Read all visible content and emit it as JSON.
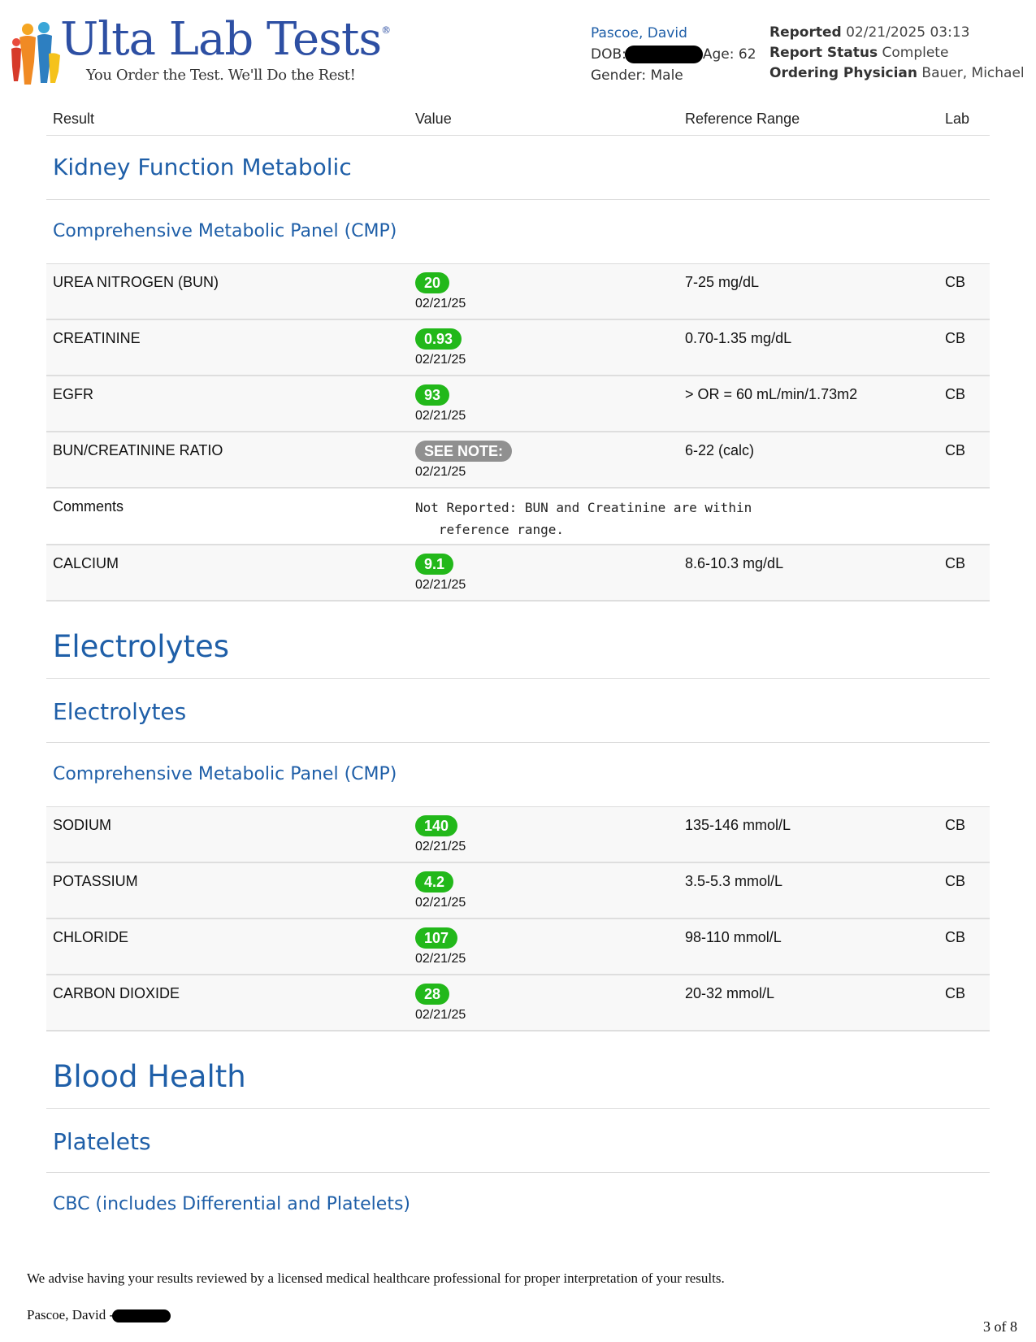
{
  "brand": {
    "title": "Ulta Lab Tests",
    "registered": "®",
    "tagline": "You Order the Test. We'll Do the Rest!"
  },
  "patient": {
    "name": "Pascoe, David",
    "dob_label": "DOB:",
    "age_label": "Age:",
    "age_value": "62",
    "gender_label": "Gender:",
    "gender_value": "Male"
  },
  "report": {
    "reported_label": "Reported",
    "reported_value": "02/21/2025 03:13",
    "status_label": "Report Status",
    "status_value": "Complete",
    "physician_label": "Ordering Physician",
    "physician_value": "Bauer, Michael"
  },
  "columns": {
    "result": "Result",
    "value": "Value",
    "range": "Reference Range",
    "lab": "Lab"
  },
  "kidney": {
    "section": "Kidney Function Metabolic",
    "panel": "Comprehensive Metabolic Panel (CMP)",
    "rows": [
      {
        "name": "UREA NITROGEN (BUN)",
        "value": "20",
        "date": "02/21/25",
        "range": "7-25 mg/dL",
        "lab": "CB"
      },
      {
        "name": "CREATININE",
        "value": "0.93",
        "date": "02/21/25",
        "range": "0.70-1.35 mg/dL",
        "lab": "CB"
      },
      {
        "name": "EGFR",
        "value": "93",
        "date": "02/21/25",
        "range": "> OR = 60 mL/min/1.73m2",
        "lab": "CB"
      },
      {
        "name": "BUN/CREATININE RATIO",
        "value": "SEE NOTE:",
        "date": "02/21/25",
        "range": "6-22 (calc)",
        "lab": "CB"
      }
    ],
    "comment_label": "Comments",
    "comment_text": "Not Reported: BUN and Creatinine are within\n   reference range.",
    "calcium": {
      "name": "CALCIUM",
      "value": "9.1",
      "date": "02/21/25",
      "range": "8.6-10.3 mg/dL",
      "lab": "CB"
    }
  },
  "electrolytes": {
    "section": "Electrolytes",
    "subsection": "Electrolytes",
    "panel": "Comprehensive Metabolic Panel (CMP)",
    "rows": [
      {
        "name": "SODIUM",
        "value": "140",
        "date": "02/21/25",
        "range": "135-146 mmol/L",
        "lab": "CB"
      },
      {
        "name": "POTASSIUM",
        "value": "4.2",
        "date": "02/21/25",
        "range": "3.5-5.3 mmol/L",
        "lab": "CB"
      },
      {
        "name": "CHLORIDE",
        "value": "107",
        "date": "02/21/25",
        "range": "98-110 mmol/L",
        "lab": "CB"
      },
      {
        "name": "CARBON DIOXIDE",
        "value": "28",
        "date": "02/21/25",
        "range": "20-32 mmol/L",
        "lab": "CB"
      }
    ]
  },
  "blood": {
    "section": "Blood Health",
    "subsection": "Platelets",
    "panel": "CBC (includes Differential and Platelets)"
  },
  "footer": {
    "advice": "We advise having your results reviewed by a licensed medical healthcare professional for proper interpretation of your results.",
    "name": "Pascoe, David -",
    "page": "3 of 8"
  },
  "colors": {
    "accent_blue": "#1f5fa8",
    "normal_green": "#22b81a",
    "note_gray": "#909090"
  }
}
